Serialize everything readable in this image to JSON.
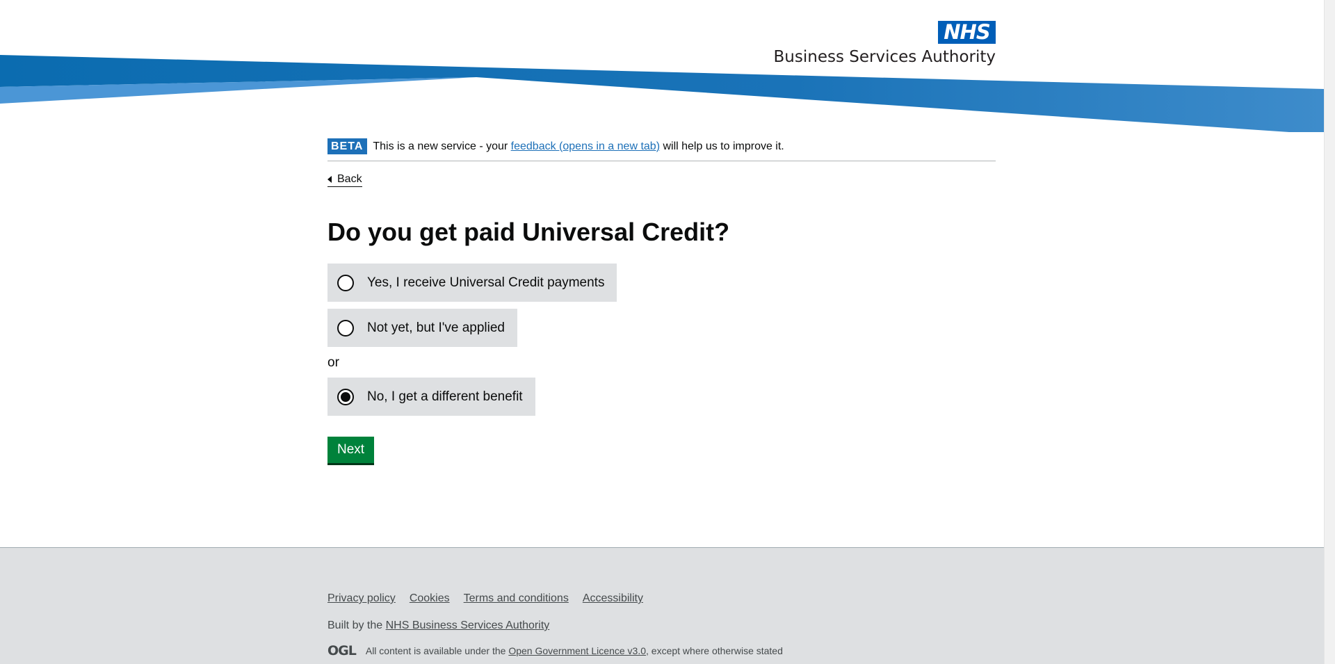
{
  "header": {
    "logo_nhs": "NHS",
    "logo_org": "Business Services Authority",
    "brand_color": "#005eb8"
  },
  "phase_banner": {
    "tag": "BETA",
    "text_before": "This is a new service - your ",
    "link_text": "feedback (opens in a new tab)",
    "text_after": " will help us to improve it."
  },
  "back_link": "Back",
  "question": {
    "title": "Do you get paid Universal Credit?",
    "options": [
      {
        "label": "Yes, I receive Universal Credit payments",
        "checked": false
      },
      {
        "label": "Not yet, but I've applied",
        "checked": false
      },
      {
        "label": "No, I get a different benefit",
        "checked": true
      }
    ],
    "divider": "or"
  },
  "actions": {
    "next_label": "Next",
    "button_color": "#00823b"
  },
  "footer": {
    "links": [
      "Privacy policy",
      "Cookies",
      "Terms and conditions",
      "Accessibility"
    ],
    "built_by_prefix": "Built by the ",
    "built_by_link": "NHS Business Services Authority",
    "ogl_logo": "OGL",
    "licence_prefix": "All content is available under the ",
    "licence_link": "Open Government Licence v3.0",
    "licence_suffix": ", except where otherwise stated"
  }
}
